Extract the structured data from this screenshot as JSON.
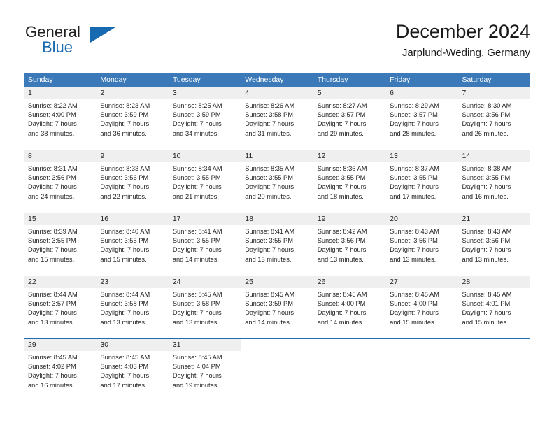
{
  "brand": {
    "word1": "General",
    "word2": "Blue",
    "logo_icon": "triangle-logo-icon",
    "accent_color": "#1769b0"
  },
  "header": {
    "title": "December 2024",
    "subtitle": "Jarplund-Weding, Germany"
  },
  "calendar": {
    "header_color": "#3b79b8",
    "separator_color": "#1f6cb0",
    "daynum_band_color": "#efefef",
    "weekdays": [
      "Sunday",
      "Monday",
      "Tuesday",
      "Wednesday",
      "Thursday",
      "Friday",
      "Saturday"
    ],
    "weeks": [
      [
        {
          "day": "1",
          "sunrise": "Sunrise: 8:22 AM",
          "sunset": "Sunset: 4:00 PM",
          "daylight1": "Daylight: 7 hours",
          "daylight2": "and 38 minutes."
        },
        {
          "day": "2",
          "sunrise": "Sunrise: 8:23 AM",
          "sunset": "Sunset: 3:59 PM",
          "daylight1": "Daylight: 7 hours",
          "daylight2": "and 36 minutes."
        },
        {
          "day": "3",
          "sunrise": "Sunrise: 8:25 AM",
          "sunset": "Sunset: 3:59 PM",
          "daylight1": "Daylight: 7 hours",
          "daylight2": "and 34 minutes."
        },
        {
          "day": "4",
          "sunrise": "Sunrise: 8:26 AM",
          "sunset": "Sunset: 3:58 PM",
          "daylight1": "Daylight: 7 hours",
          "daylight2": "and 31 minutes."
        },
        {
          "day": "5",
          "sunrise": "Sunrise: 8:27 AM",
          "sunset": "Sunset: 3:57 PM",
          "daylight1": "Daylight: 7 hours",
          "daylight2": "and 29 minutes."
        },
        {
          "day": "6",
          "sunrise": "Sunrise: 8:29 AM",
          "sunset": "Sunset: 3:57 PM",
          "daylight1": "Daylight: 7 hours",
          "daylight2": "and 28 minutes."
        },
        {
          "day": "7",
          "sunrise": "Sunrise: 8:30 AM",
          "sunset": "Sunset: 3:56 PM",
          "daylight1": "Daylight: 7 hours",
          "daylight2": "and 26 minutes."
        }
      ],
      [
        {
          "day": "8",
          "sunrise": "Sunrise: 8:31 AM",
          "sunset": "Sunset: 3:56 PM",
          "daylight1": "Daylight: 7 hours",
          "daylight2": "and 24 minutes."
        },
        {
          "day": "9",
          "sunrise": "Sunrise: 8:33 AM",
          "sunset": "Sunset: 3:56 PM",
          "daylight1": "Daylight: 7 hours",
          "daylight2": "and 22 minutes."
        },
        {
          "day": "10",
          "sunrise": "Sunrise: 8:34 AM",
          "sunset": "Sunset: 3:55 PM",
          "daylight1": "Daylight: 7 hours",
          "daylight2": "and 21 minutes."
        },
        {
          "day": "11",
          "sunrise": "Sunrise: 8:35 AM",
          "sunset": "Sunset: 3:55 PM",
          "daylight1": "Daylight: 7 hours",
          "daylight2": "and 20 minutes."
        },
        {
          "day": "12",
          "sunrise": "Sunrise: 8:36 AM",
          "sunset": "Sunset: 3:55 PM",
          "daylight1": "Daylight: 7 hours",
          "daylight2": "and 18 minutes."
        },
        {
          "day": "13",
          "sunrise": "Sunrise: 8:37 AM",
          "sunset": "Sunset: 3:55 PM",
          "daylight1": "Daylight: 7 hours",
          "daylight2": "and 17 minutes."
        },
        {
          "day": "14",
          "sunrise": "Sunrise: 8:38 AM",
          "sunset": "Sunset: 3:55 PM",
          "daylight1": "Daylight: 7 hours",
          "daylight2": "and 16 minutes."
        }
      ],
      [
        {
          "day": "15",
          "sunrise": "Sunrise: 8:39 AM",
          "sunset": "Sunset: 3:55 PM",
          "daylight1": "Daylight: 7 hours",
          "daylight2": "and 15 minutes."
        },
        {
          "day": "16",
          "sunrise": "Sunrise: 8:40 AM",
          "sunset": "Sunset: 3:55 PM",
          "daylight1": "Daylight: 7 hours",
          "daylight2": "and 15 minutes."
        },
        {
          "day": "17",
          "sunrise": "Sunrise: 8:41 AM",
          "sunset": "Sunset: 3:55 PM",
          "daylight1": "Daylight: 7 hours",
          "daylight2": "and 14 minutes."
        },
        {
          "day": "18",
          "sunrise": "Sunrise: 8:41 AM",
          "sunset": "Sunset: 3:55 PM",
          "daylight1": "Daylight: 7 hours",
          "daylight2": "and 13 minutes."
        },
        {
          "day": "19",
          "sunrise": "Sunrise: 8:42 AM",
          "sunset": "Sunset: 3:56 PM",
          "daylight1": "Daylight: 7 hours",
          "daylight2": "and 13 minutes."
        },
        {
          "day": "20",
          "sunrise": "Sunrise: 8:43 AM",
          "sunset": "Sunset: 3:56 PM",
          "daylight1": "Daylight: 7 hours",
          "daylight2": "and 13 minutes."
        },
        {
          "day": "21",
          "sunrise": "Sunrise: 8:43 AM",
          "sunset": "Sunset: 3:56 PM",
          "daylight1": "Daylight: 7 hours",
          "daylight2": "and 13 minutes."
        }
      ],
      [
        {
          "day": "22",
          "sunrise": "Sunrise: 8:44 AM",
          "sunset": "Sunset: 3:57 PM",
          "daylight1": "Daylight: 7 hours",
          "daylight2": "and 13 minutes."
        },
        {
          "day": "23",
          "sunrise": "Sunrise: 8:44 AM",
          "sunset": "Sunset: 3:58 PM",
          "daylight1": "Daylight: 7 hours",
          "daylight2": "and 13 minutes."
        },
        {
          "day": "24",
          "sunrise": "Sunrise: 8:45 AM",
          "sunset": "Sunset: 3:58 PM",
          "daylight1": "Daylight: 7 hours",
          "daylight2": "and 13 minutes."
        },
        {
          "day": "25",
          "sunrise": "Sunrise: 8:45 AM",
          "sunset": "Sunset: 3:59 PM",
          "daylight1": "Daylight: 7 hours",
          "daylight2": "and 14 minutes."
        },
        {
          "day": "26",
          "sunrise": "Sunrise: 8:45 AM",
          "sunset": "Sunset: 4:00 PM",
          "daylight1": "Daylight: 7 hours",
          "daylight2": "and 14 minutes."
        },
        {
          "day": "27",
          "sunrise": "Sunrise: 8:45 AM",
          "sunset": "Sunset: 4:00 PM",
          "daylight1": "Daylight: 7 hours",
          "daylight2": "and 15 minutes."
        },
        {
          "day": "28",
          "sunrise": "Sunrise: 8:45 AM",
          "sunset": "Sunset: 4:01 PM",
          "daylight1": "Daylight: 7 hours",
          "daylight2": "and 15 minutes."
        }
      ],
      [
        {
          "day": "29",
          "sunrise": "Sunrise: 8:45 AM",
          "sunset": "Sunset: 4:02 PM",
          "daylight1": "Daylight: 7 hours",
          "daylight2": "and 16 minutes."
        },
        {
          "day": "30",
          "sunrise": "Sunrise: 8:45 AM",
          "sunset": "Sunset: 4:03 PM",
          "daylight1": "Daylight: 7 hours",
          "daylight2": "and 17 minutes."
        },
        {
          "day": "31",
          "sunrise": "Sunrise: 8:45 AM",
          "sunset": "Sunset: 4:04 PM",
          "daylight1": "Daylight: 7 hours",
          "daylight2": "and 19 minutes."
        },
        {
          "day": "",
          "sunrise": "",
          "sunset": "",
          "daylight1": "",
          "daylight2": ""
        },
        {
          "day": "",
          "sunrise": "",
          "sunset": "",
          "daylight1": "",
          "daylight2": ""
        },
        {
          "day": "",
          "sunrise": "",
          "sunset": "",
          "daylight1": "",
          "daylight2": ""
        },
        {
          "day": "",
          "sunrise": "",
          "sunset": "",
          "daylight1": "",
          "daylight2": ""
        }
      ]
    ]
  }
}
